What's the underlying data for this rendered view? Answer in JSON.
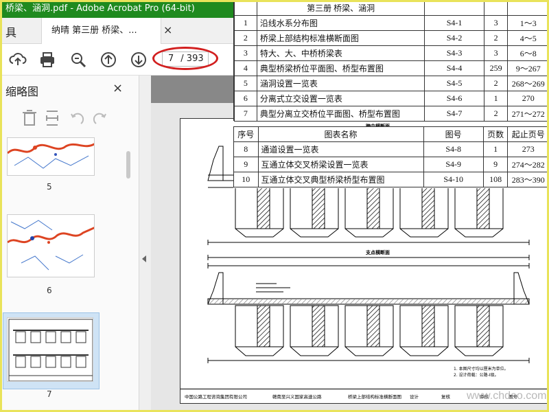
{
  "window": {
    "title": "桥梁、涵洞.pdf - Adobe Acrobat Pro (64-bit)",
    "watermark": "CHDAO"
  },
  "tabs": {
    "tools_label": "具",
    "doc_tab_label": "纳晴 第三册 桥梁、...",
    "close_glyph": "×"
  },
  "toolbar": {
    "current_page": "7",
    "total_pages": "/ 393",
    "icons": [
      "cloud-upload-icon",
      "print-icon",
      "zoom-icon",
      "page-up-icon",
      "page-down-icon"
    ]
  },
  "sidebar": {
    "title": "缩略图",
    "close_glyph": "×",
    "thumbnails": [
      {
        "page": "5"
      },
      {
        "page": "6"
      },
      {
        "page": "7",
        "selected": true
      }
    ]
  },
  "toc": {
    "book_heading": "第三册  桥梁、涵洞",
    "header": {
      "no": "序号",
      "name": "图表名称",
      "code": "图号",
      "pages": "页数",
      "range": "起止页号"
    },
    "rows_top": [
      {
        "no": "1",
        "name": "沿线水系分布图",
        "code": "S4-1",
        "pages": "3",
        "range": "1～3"
      },
      {
        "no": "2",
        "name": "桥梁上部结构标准横断面图",
        "code": "S4-2",
        "pages": "2",
        "range": "4～5"
      },
      {
        "no": "3",
        "name": "特大、大、中桥桥梁表",
        "code": "S4-3",
        "pages": "3",
        "range": "6～8"
      },
      {
        "no": "4",
        "name": "典型桥梁桥位平面图、桥型布置图",
        "code": "S4-4",
        "pages": "259",
        "range": "9～267"
      },
      {
        "no": "5",
        "name": "涵洞设置一览表",
        "code": "S4-5",
        "pages": "2",
        "range": "268～269"
      },
      {
        "no": "6",
        "name": "分离式立交设置一览表",
        "code": "S4-6",
        "pages": "1",
        "range": "270"
      },
      {
        "no": "7",
        "name": "典型分离立交桥位平面图、桥型布置图",
        "code": "S4-7",
        "pages": "2",
        "range": "271～272"
      }
    ],
    "rows_bottom": [
      {
        "no": "8",
        "name": "通道设置一览表",
        "code": "S4-8",
        "pages": "1",
        "range": "273"
      },
      {
        "no": "9",
        "name": "互通立体交叉桥梁设置一览表",
        "code": "S4-9",
        "pages": "9",
        "range": "274～282"
      },
      {
        "no": "10",
        "name": "互通立体交叉典型桥梁桥型布置图",
        "code": "S4-10",
        "pages": "108",
        "range": "283～390"
      }
    ]
  },
  "drawing": {
    "title_top": "跨中横断面",
    "title_mid": "支点横断面",
    "notes": [
      "1. 本图尺寸均以厘米为单位。",
      "2. 设计荷载：公路-I级。"
    ],
    "titleblock": {
      "company": "中国公路工程咨询集团有限公司",
      "project": "赣南至兴义国家高速公路",
      "sheet": "桥梁上部结构标准横断面图",
      "design": "设计",
      "review": "复核",
      "check": "审核",
      "drawing_no": "图号"
    }
  },
  "watermark_br": "www.chdao.com",
  "colors": {
    "titlebar": "#1f8a1f",
    "highlight_ellipse": "#d21f1f",
    "frame": "#e9e35a"
  }
}
